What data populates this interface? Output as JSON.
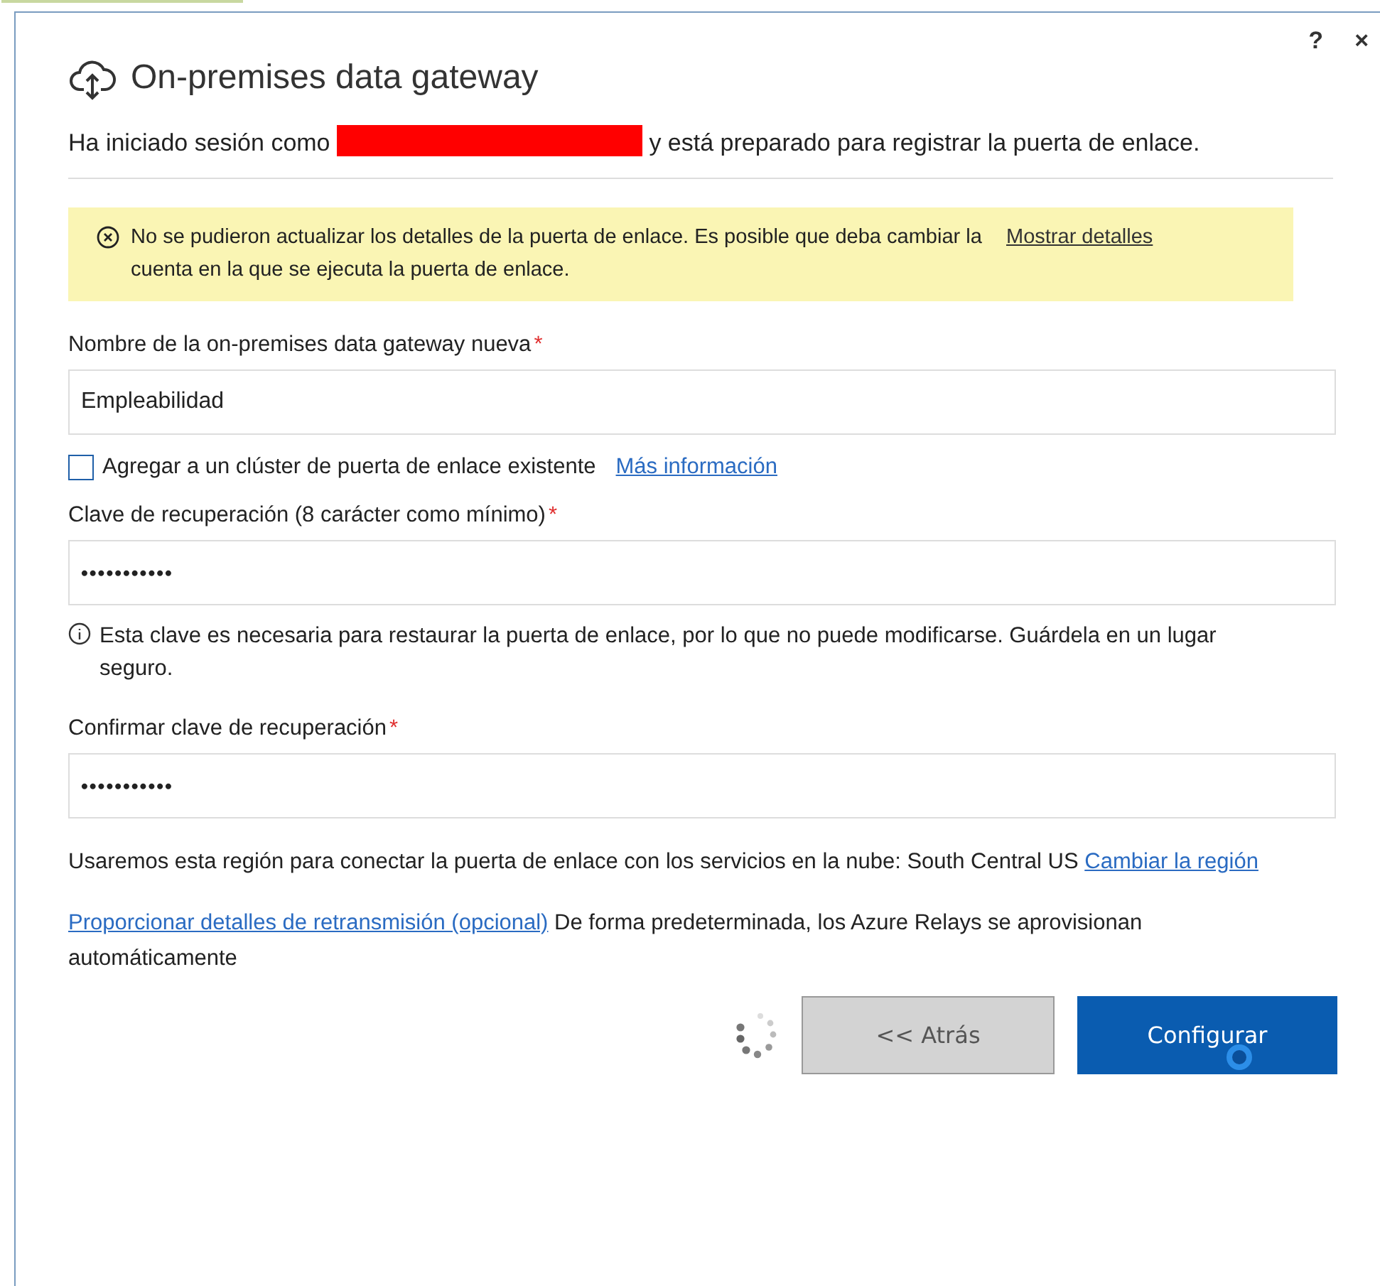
{
  "window": {
    "help": "?",
    "close": "×",
    "title": "On-premises data gateway"
  },
  "signin": {
    "before": "Ha iniciado sesión como",
    "redacted": true,
    "after": "y está preparado para registrar la puerta de enlace."
  },
  "warning": {
    "text": "No se pudieron actualizar los detalles de la puerta de enlace. Es posible que deba cambiar la cuenta en la que se ejecuta la puerta de enlace.",
    "link": "Mostrar detalles"
  },
  "name_field": {
    "label": "Nombre de la on-premises data gateway nueva",
    "required_mark": "*",
    "value": "Empleabilidad"
  },
  "cluster": {
    "label": "Agregar a un clúster de puerta de enlace existente",
    "checked": false,
    "link": "Más información"
  },
  "key_field": {
    "label": "Clave de recuperación (8 carácter como mínimo)",
    "required_mark": "*",
    "value": "•••••••••••"
  },
  "key_note": "Esta clave es necesaria para restaurar la puerta de enlace, por lo que no puede modificarse. Guárdela en un lugar seguro.",
  "confirm_field": {
    "label": "Confirmar clave de recuperación",
    "required_mark": "*",
    "value": "•••••••••••"
  },
  "region": {
    "text": "Usaremos esta región para conectar la puerta de enlace con los servicios en la nube: South Central US",
    "link": "Cambiar la región"
  },
  "relay": {
    "link": "Proporcionar detalles de retransmisión (opcional)",
    "text": "De forma predeterminada, los Azure Relays se aprovisionan automáticamente"
  },
  "busy": true,
  "buttons": [
    {
      "label": "<< Atrás",
      "kind": "secondary",
      "disabled": true
    },
    {
      "label": "Configurar",
      "kind": "primary",
      "disabled": false
    }
  ]
}
